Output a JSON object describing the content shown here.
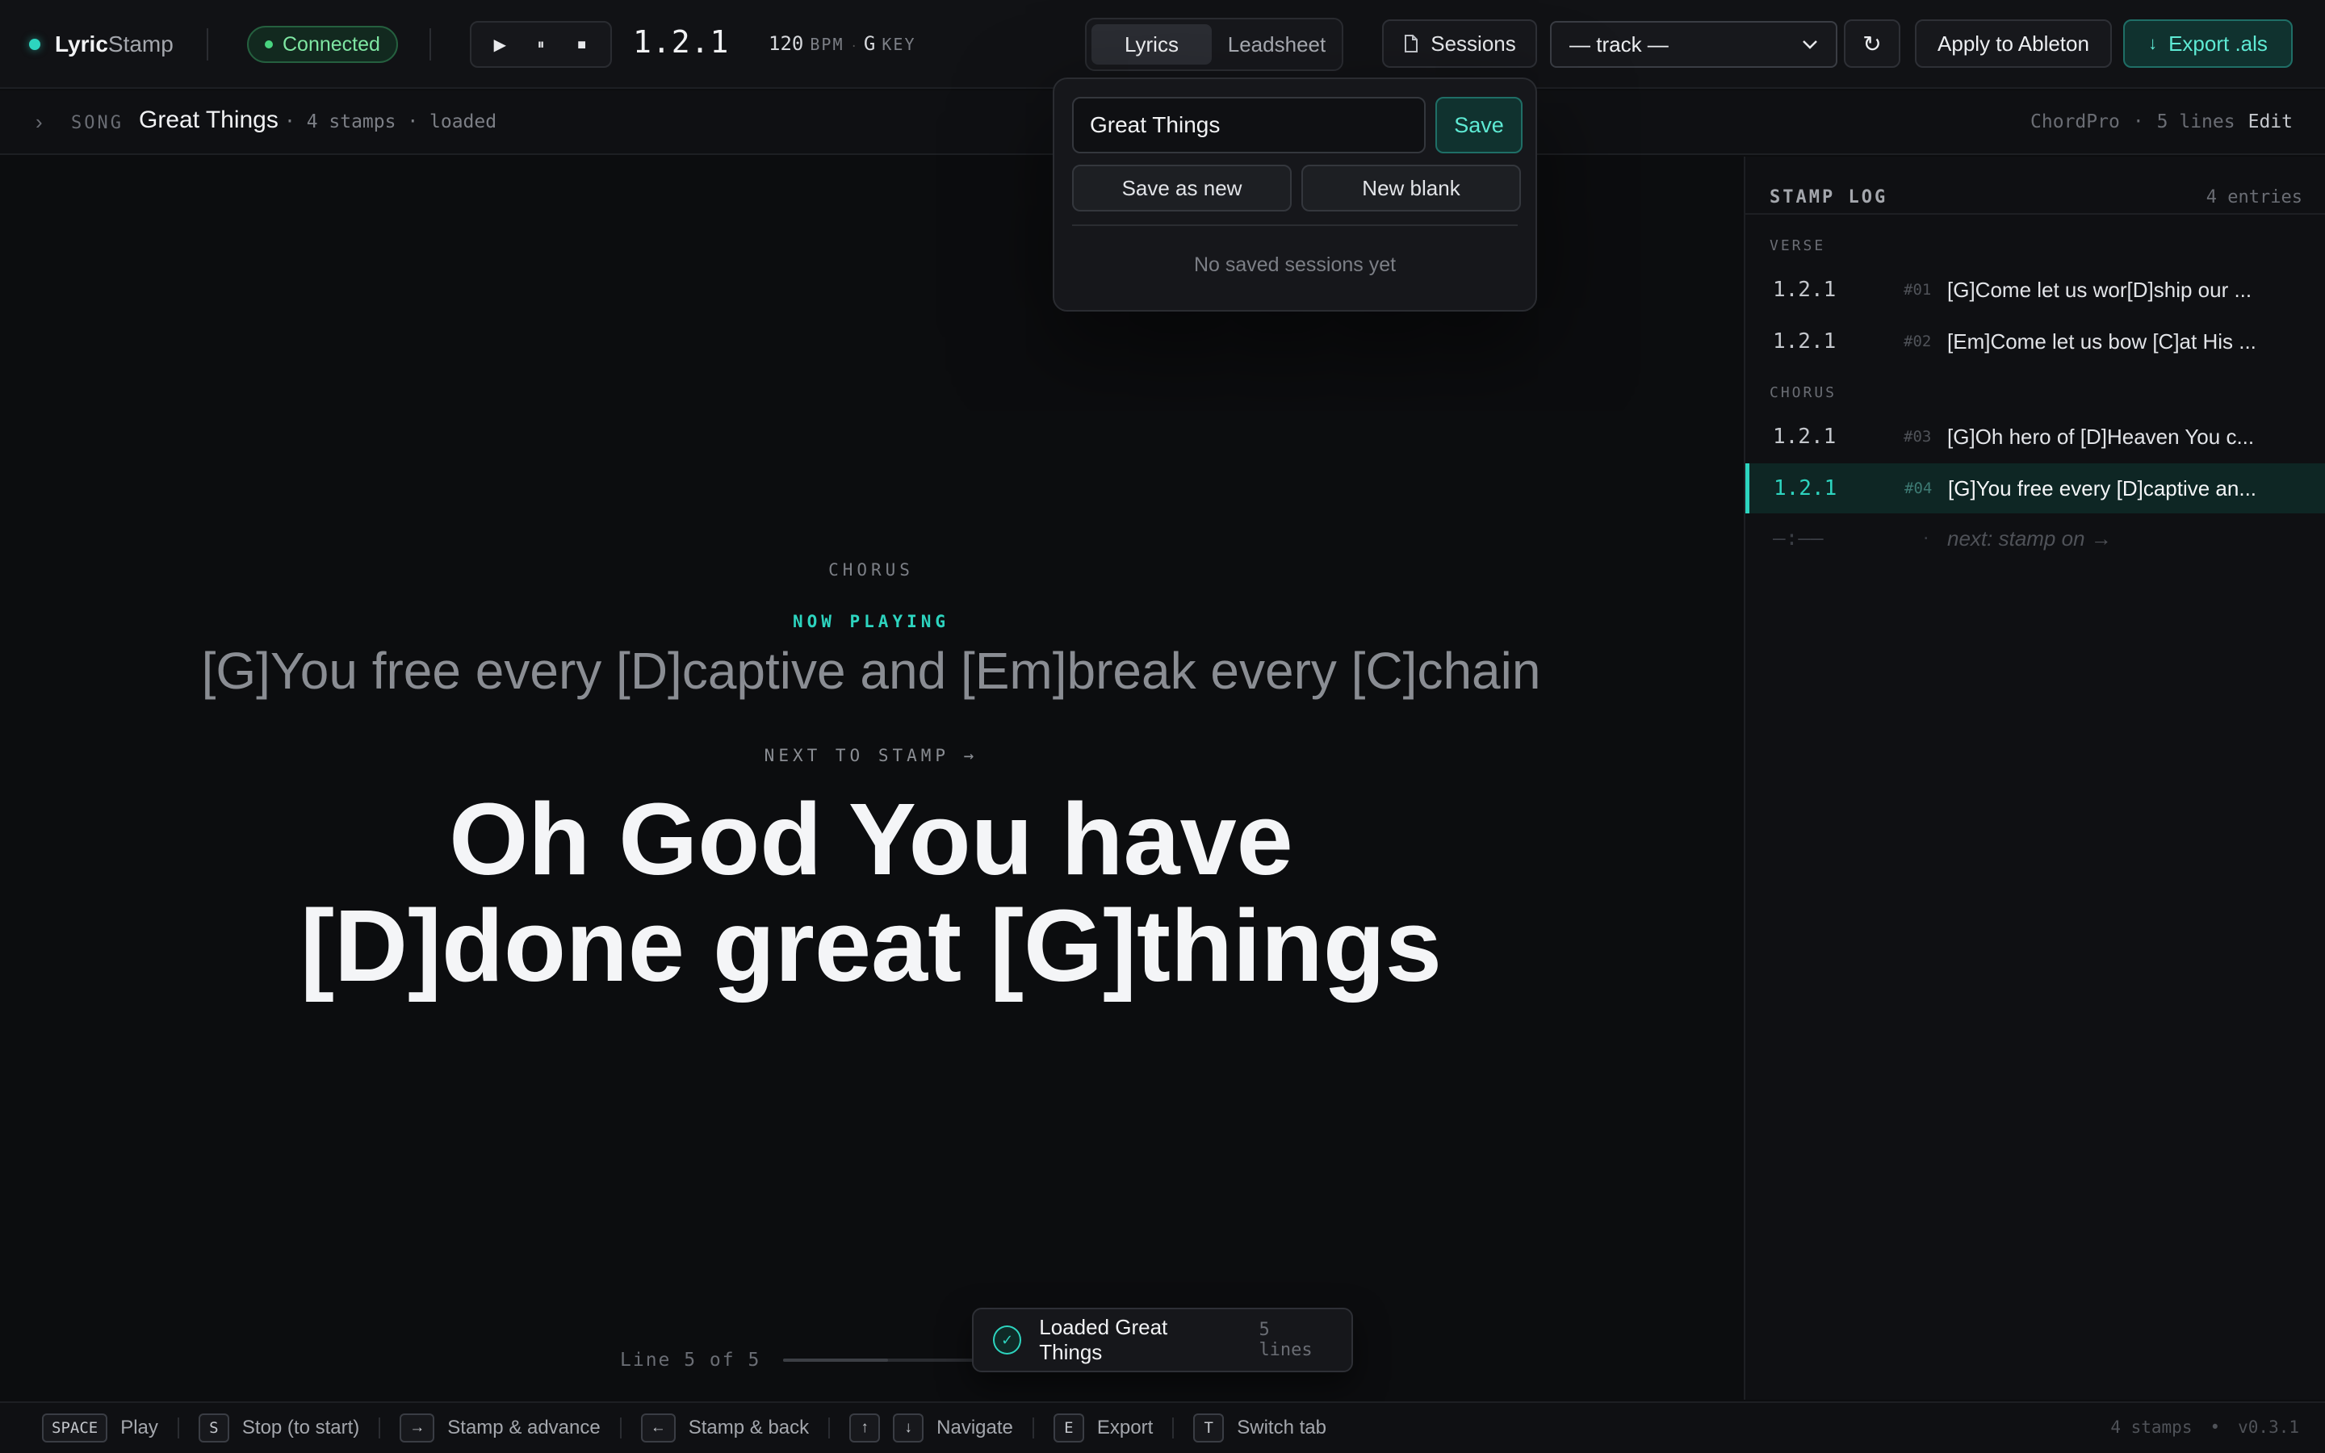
{
  "app": {
    "name_bold": "Lyric",
    "name_light": "Stamp"
  },
  "connection": {
    "status": "Connected"
  },
  "transport": {
    "play_icon": "▶",
    "pause_icon": "⏸",
    "stop_icon": "■",
    "position": "1.2.1"
  },
  "tempo": {
    "bpm": "120",
    "bpm_label": "BPM",
    "sep": "·",
    "key": "G",
    "key_label": "KEY"
  },
  "tabs": [
    {
      "label": "Lyrics",
      "active": true
    },
    {
      "label": "Leadsheet",
      "active": false
    }
  ],
  "toolbar": {
    "sessions_label": "Sessions",
    "track_select_value": "— track —",
    "refresh_icon": "↻",
    "apply_label": "Apply to Ableton",
    "export_label": "Export .als",
    "export_icon": "↓"
  },
  "song": {
    "label": "SONG",
    "title": "Great Things",
    "meta": "· 4 stamps · loaded",
    "format": "ChordPro",
    "sep": "·",
    "lines": "5 lines",
    "edit_label": "Edit"
  },
  "stage": {
    "section": "CHORUS",
    "now_label": "NOW PLAYING",
    "now_line": "[G]You free every [D]captive and [Em]break every [C]chain",
    "next_label": "NEXT TO STAMP →",
    "next_line_1": "Oh God You have",
    "next_line_2": "[D]done great [G]things",
    "progress_text": "Line 5 of 5",
    "progress_fraction": 0.2
  },
  "stamp_log": {
    "title": "STAMP LOG",
    "count": "4 entries",
    "groups": [
      {
        "name": "VERSE",
        "entries": [
          {
            "pos": "1.2.1",
            "idx": "#01",
            "lyric": "[G]Come let us wor[D]ship our ..."
          },
          {
            "pos": "1.2.1",
            "idx": "#02",
            "lyric": "[Em]Come let us bow [C]at His ..."
          }
        ]
      },
      {
        "name": "CHORUS",
        "entries": [
          {
            "pos": "1.2.1",
            "idx": "#03",
            "lyric": "[G]Oh hero of [D]Heaven You c..."
          },
          {
            "pos": "1.2.1",
            "idx": "#04",
            "lyric": "[G]You free every [D]captive an..."
          }
        ]
      }
    ],
    "pending": {
      "pos": "—:——",
      "idx": "·",
      "lyric": "next: stamp on →"
    }
  },
  "sessions_popover": {
    "name_value": "Great Things",
    "save_label": "Save",
    "save_as_new_label": "Save as new",
    "new_blank_label": "New blank",
    "empty_text": "No saved sessions yet"
  },
  "toast": {
    "message": "Loaded Great Things",
    "meta": "5 lines",
    "icon": "✓"
  },
  "shortcuts": [
    {
      "keys": [
        "SPACE"
      ],
      "label": "Play"
    },
    {
      "keys": [
        "S"
      ],
      "label": "Stop (to start)"
    },
    {
      "keys": [
        "→"
      ],
      "label": "Stamp & advance"
    },
    {
      "keys": [
        "←"
      ],
      "label": "Stamp & back"
    },
    {
      "keys": [
        "↑",
        "↓"
      ],
      "label": "Navigate"
    },
    {
      "keys": [
        "E"
      ],
      "label": "Export"
    },
    {
      "keys": [
        "T"
      ],
      "label": "Switch tab"
    }
  ],
  "footer": {
    "stamps": "4 stamps",
    "sep": "•",
    "version": "v0.3.1"
  },
  "colors": {
    "accent": "#2dd4bf",
    "connected": "#48d47f",
    "background": "#0c0d0f"
  }
}
